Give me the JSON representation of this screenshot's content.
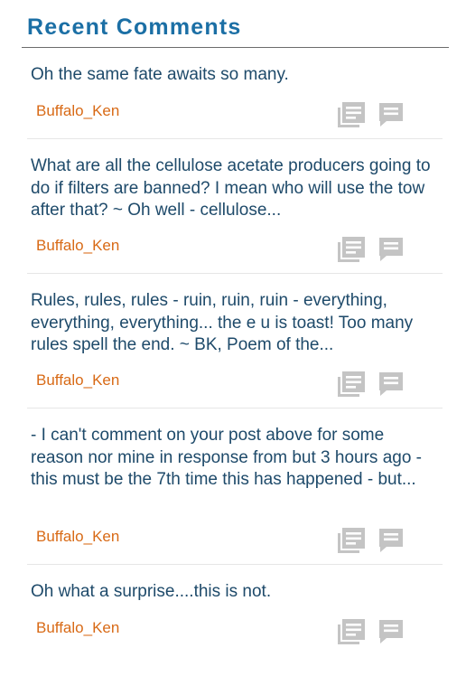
{
  "widget": {
    "title": "Recent Comments"
  },
  "comments": [
    {
      "excerpt": "Oh the same fate awaits so many.",
      "author": "Buffalo_Ken",
      "post_icon": "article-icon",
      "reply_icon": "comment-bubble-icon"
    },
    {
      "excerpt": "What are all the cellulose acetate producers going to do if filters are banned? I mean who will use the tow after that? ~ Oh well - cellulose...",
      "author": "Buffalo_Ken",
      "post_icon": "article-icon",
      "reply_icon": "comment-bubble-icon"
    },
    {
      "excerpt": "Rules, rules, rules - ruin, ruin, ruin - everything, everything, everything... the e u is toast! Too many rules spell the end. ~ BK, Poem of the...",
      "author": "Buffalo_Ken",
      "post_icon": "article-icon",
      "reply_icon": "comment-bubble-icon"
    },
    {
      "excerpt": "- I can't comment on your post above for some reason nor mine in response from but 3 hours ago - this must be the 7th time this has happened - but...",
      "author": "Buffalo_Ken",
      "post_icon": "article-icon",
      "reply_icon": "comment-bubble-icon"
    },
    {
      "excerpt": "Oh what a surprise....this is not.",
      "author": "Buffalo_Ken",
      "post_icon": "article-icon",
      "reply_icon": "comment-bubble-icon"
    }
  ],
  "colors": {
    "title": "#1b6fa5",
    "excerpt": "#1e4a6a",
    "author": "#d86a16",
    "icon": "#c4c4c4"
  }
}
